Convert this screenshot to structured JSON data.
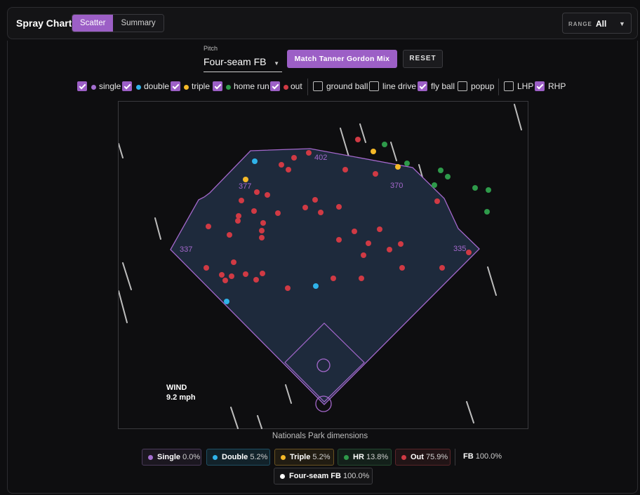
{
  "header": {
    "title": "Spray Chart",
    "tabs": [
      {
        "label": "Scatter",
        "active": true
      },
      {
        "label": "Summary",
        "active": false
      }
    ],
    "range": {
      "label": "RANGE",
      "value": "All"
    }
  },
  "controls": {
    "pitch_label": "Pitch",
    "pitch_value": "Four-seam FB",
    "match_button": "Match Tanner Gordon Mix",
    "reset_button": "RESET"
  },
  "filters": {
    "single": "single",
    "double": "double",
    "triple": "triple",
    "home_run": "home run",
    "out": "out",
    "ground_ball": "ground ball",
    "line_drive": "line drive",
    "fly_ball": "fly ball",
    "popup": "popup",
    "lhp": "LHP",
    "rhp": "RHP"
  },
  "filter_state": {
    "single": true,
    "double": true,
    "triple": true,
    "home_run": true,
    "out": true,
    "ground_ball": false,
    "line_drive": false,
    "fly_ball": true,
    "popup": false,
    "lhp": false,
    "rhp": true
  },
  "colors": {
    "accent": "#9c5fc6",
    "single": "#a46fd0",
    "double": "#2fb3ea",
    "triple": "#f5b928",
    "home_run": "#2e9a4a",
    "out": "#d03a44",
    "field_fill": "#1e2a3c",
    "field_line": "#a468cc"
  },
  "field": {
    "distances": {
      "left": "337",
      "left_center": "377",
      "center": "402",
      "right_center": "370",
      "right": "335"
    },
    "wind_label": "WIND",
    "wind_value": "9.2 mph",
    "caption": "Nationals Park dimensions"
  },
  "summary": {
    "single": {
      "label": "Single",
      "pct": "0.0%"
    },
    "double": {
      "label": "Double",
      "pct": "5.2%"
    },
    "triple": {
      "label": "Triple",
      "pct": "5.2%"
    },
    "hr": {
      "label": "HR",
      "pct": "13.8%"
    },
    "out": {
      "label": "Out",
      "pct": "75.9%"
    },
    "fb": {
      "label": "FB",
      "pct": "100.0%"
    },
    "pitch": {
      "label": "Four-seam FB",
      "pct": "100.0%"
    }
  }
}
